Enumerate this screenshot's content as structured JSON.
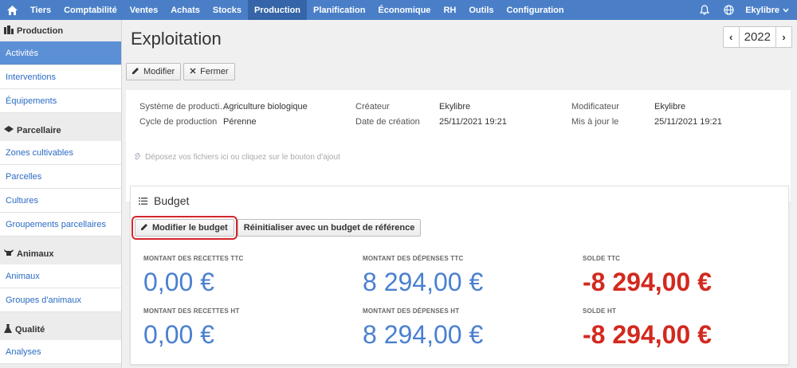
{
  "topnav": {
    "items": [
      "Tiers",
      "Comptabilité",
      "Ventes",
      "Achats",
      "Stocks",
      "Production",
      "Planification",
      "Économique",
      "RH",
      "Outils",
      "Configuration"
    ],
    "active": "Production",
    "user": "Ekylibre"
  },
  "sidebar": {
    "sections": [
      {
        "title": "Production",
        "icon": "production-icon",
        "items": [
          "Activités",
          "Interventions",
          "Équipements"
        ]
      },
      {
        "title": "Parcellaire",
        "icon": "parcel-icon",
        "items": [
          "Zones cultivables",
          "Parcelles",
          "Cultures",
          "Groupements parcellaires"
        ]
      },
      {
        "title": "Animaux",
        "icon": "animal-icon",
        "items": [
          "Animaux",
          "Groupes d'animaux"
        ]
      },
      {
        "title": "Qualité",
        "icon": "flask-icon",
        "items": [
          "Analyses"
        ]
      }
    ],
    "active_item": "Activités"
  },
  "page": {
    "title": "Exploitation",
    "year": "2022",
    "toolbar": {
      "edit": "Modifier",
      "close": "Fermer"
    }
  },
  "info": {
    "production_system_label": "Système de producti…",
    "production_system": "Agriculture biologique",
    "cycle_label": "Cycle de production",
    "cycle": "Pérenne",
    "creator_label": "Créateur",
    "creator": "Ekylibre",
    "created_label": "Date de création",
    "created": "25/11/2021 19:21",
    "modifier_label": "Modificateur",
    "modifier": "Ekylibre",
    "updated_label": "Mis à jour le",
    "updated": "25/11/2021 19:21",
    "dropzone": "Déposez vos fichiers ici ou cliquez sur le bouton d'ajout"
  },
  "budget": {
    "title": "Budget",
    "edit_button": "Modifier le budget",
    "reset_button": "Réinitialiser avec un budget de référence",
    "recettes_ttc_label": "MONTANT DES RECETTES TTC",
    "recettes_ttc": "0,00 €",
    "depenses_ttc_label": "MONTANT DES DÉPENSES TTC",
    "depenses_ttc": "8 294,00 €",
    "solde_ttc_label": "SOLDE TTC",
    "solde_ttc": "-8 294,00 €",
    "recettes_ht_label": "MONTANT DES RECETTES HT",
    "recettes_ht": "0,00 €",
    "depenses_ht_label": "MONTANT DES DÉPENSES HT",
    "depenses_ht": "8 294,00 €",
    "solde_ht_label": "SOLDE HT",
    "solde_ht": "-8 294,00 €"
  },
  "colors": {
    "nav": "#4a7fc8",
    "positive": "#4a80d0",
    "negative": "#d3291f",
    "highlight": "#d3262b"
  }
}
